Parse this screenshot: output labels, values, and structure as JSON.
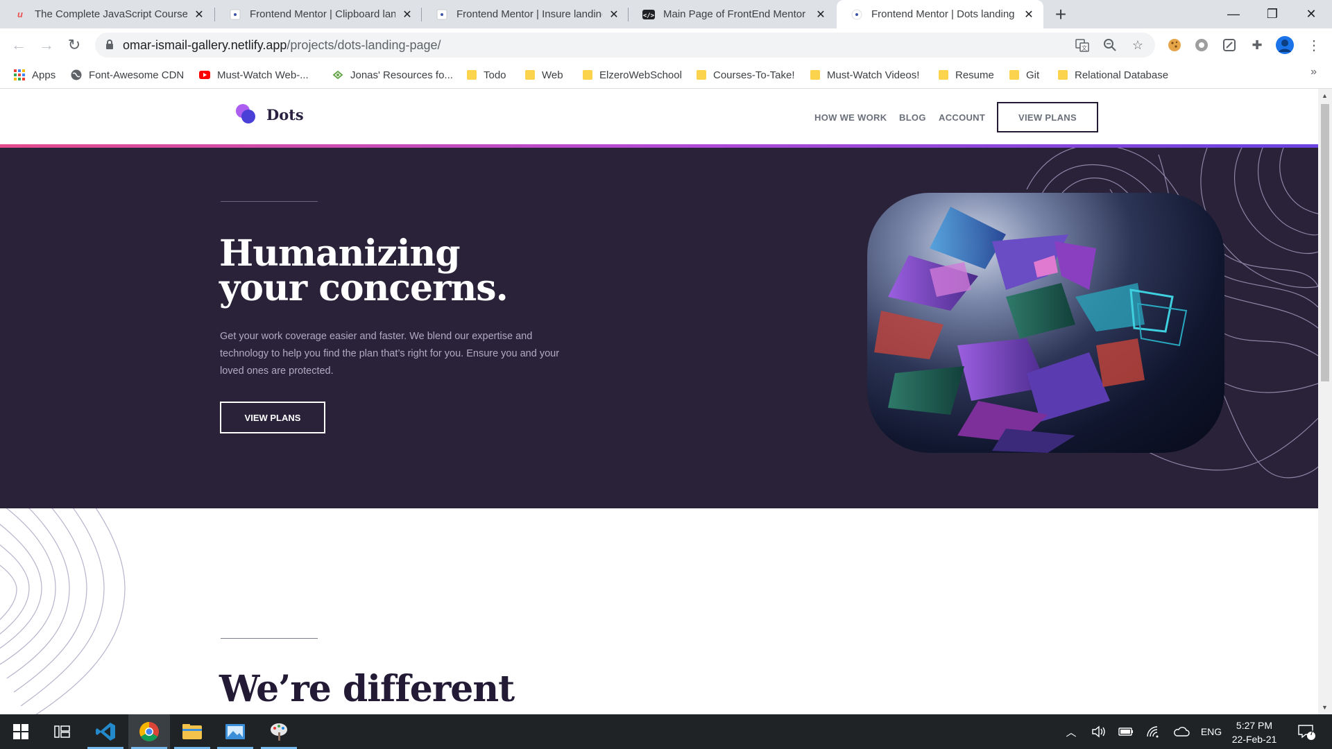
{
  "browser": {
    "tabs": [
      {
        "title": "The Complete JavaScript Course",
        "favicon": "udemy-icon",
        "active": false
      },
      {
        "title": "Frontend Mentor | Clipboard lan",
        "favicon": "frontend-mentor-icon",
        "active": false
      },
      {
        "title": "Frontend Mentor | Insure landing",
        "favicon": "frontend-mentor-icon",
        "active": false
      },
      {
        "title": "Main Page of FrontEnd Mentor P",
        "favicon": "code-icon",
        "active": false
      },
      {
        "title": "Frontend Mentor | Dots landing p",
        "favicon": "frontend-mentor-icon",
        "active": true
      }
    ],
    "url": {
      "host": "omar-ismail-gallery.netlify.app",
      "path": "/projects/dots-landing-page/"
    },
    "bookmarks": [
      {
        "label": "Apps",
        "icon": "apps-grid-icon"
      },
      {
        "label": "Font-Awesome CDN",
        "icon": "globe-icon"
      },
      {
        "label": "Must-Watch Web-...",
        "icon": "youtube-icon"
      },
      {
        "label": "Jonas' Resources fo...",
        "icon": "leaf-icon"
      },
      {
        "label": "Todo",
        "icon": "folder-icon"
      },
      {
        "label": "Web",
        "icon": "folder-icon"
      },
      {
        "label": "ElzeroWebSchool",
        "icon": "folder-icon"
      },
      {
        "label": "Courses-To-Take!",
        "icon": "folder-icon"
      },
      {
        "label": "Must-Watch Videos!",
        "icon": "folder-icon"
      },
      {
        "label": "Resume",
        "icon": "folder-icon"
      },
      {
        "label": "Git",
        "icon": "folder-icon"
      },
      {
        "label": "Relational Database",
        "icon": "folder-icon"
      }
    ]
  },
  "site": {
    "logo_text": "Dots",
    "nav": {
      "how_we_work": "HOW WE WORK",
      "blog": "BLOG",
      "account": "ACCOUNT",
      "cta": "VIEW PLANS"
    },
    "hero": {
      "title_line1": "Humanizing",
      "title_line2": "your concerns.",
      "text": "Get your work coverage easier and faster. We blend our expertise and technology to help you find the plan that’s right for you. Ensure you and your loved ones are protected.",
      "button": "VIEW PLANS"
    },
    "section2": {
      "title": "We’re different"
    }
  },
  "taskbar": {
    "clock_time": "5:27 PM",
    "clock_date": "22-Feb-21",
    "language": "ENG",
    "notification_count": "7"
  },
  "colors": {
    "hero_bg": "#292239",
    "accent_gradient": [
      "#e44c8c",
      "#b44bd6",
      "#6a43e0"
    ],
    "dark_text": "#231a35"
  }
}
